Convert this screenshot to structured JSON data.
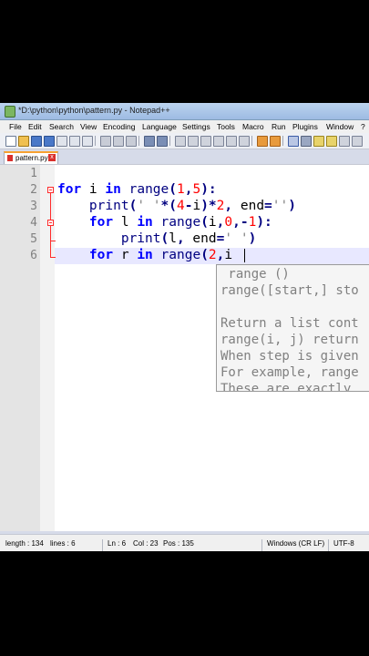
{
  "window": {
    "title": "*D:\\python\\python\\pattern.py - Notepad++"
  },
  "menu": [
    "File",
    "Edit",
    "Search",
    "View",
    "Encoding",
    "Language",
    "Settings",
    "Tools",
    "Macro",
    "Run",
    "Plugins",
    "Window",
    "?"
  ],
  "toolbar": {
    "icons": [
      "new-file-icon",
      "open-file-icon",
      "save-icon",
      "save-all-icon",
      "close-icon",
      "close-all-icon",
      "print-icon",
      "cut-icon",
      "copy-icon",
      "paste-icon",
      "undo-icon",
      "redo-icon",
      "find-icon",
      "replace-icon",
      "zoom-in-icon",
      "zoom-out-icon",
      "sync-v-icon",
      "sync-h-icon",
      "word-wrap-icon",
      "show-all-chars-icon",
      "indent-guide-icon",
      "doc-map-icon",
      "function-list-icon",
      "macro-record-icon"
    ]
  },
  "tab": {
    "label": "pattern.py",
    "close": "x"
  },
  "editor": {
    "line_numbers": [
      "1",
      "2",
      "3",
      "4",
      "5",
      "6"
    ],
    "lines": [
      {
        "t1": ""
      },
      {
        "kw1": "for",
        "t1": " i ",
        "kw2": "in",
        "t2": " ",
        "fn": "range",
        "op1": "(",
        "n1": "1",
        "op2": ",",
        "n2": "5",
        "op3": "):"
      },
      {
        "t0": "    ",
        "fn": "print",
        "op1": "(",
        "s1": "' '",
        "op2": "*(",
        "n1": "4",
        "op3": "-",
        "t1": "i",
        "op4": ")*",
        "n2": "2",
        "op5": ",",
        "t2": " end",
        "op6": "=",
        "s2": "''",
        "op7": ")"
      },
      {
        "t0": "    ",
        "kw1": "for",
        "t1": " l ",
        "kw2": "in",
        "t2": " ",
        "fn": "range",
        "op1": "(",
        "t3": "i",
        "op2": ",",
        "n1": "0",
        "op3": ",-",
        "n2": "1",
        "op4": "):"
      },
      {
        "t0": "        ",
        "fn": "print",
        "op1": "(",
        "t1": "l",
        "op2": ",",
        "t2": " end",
        "op3": "=",
        "s1": "' '",
        "op4": ")"
      },
      {
        "t0": "    ",
        "kw1": "for",
        "t1": " r ",
        "kw2": "in",
        "t2": " ",
        "fn": "range",
        "op1": "(",
        "n1": "2",
        "op2": ",",
        "t3": "i"
      }
    ]
  },
  "calltip": {
    "lines": [
      " range ()",
      "range([start,] sto",
      "",
      "Return a list cont",
      "range(i, j) return",
      "When step is given",
      "For example, range",
      "These are exactly "
    ]
  },
  "status": {
    "length": "length : 134",
    "lines": "lines : 6",
    "ln": "Ln : 6",
    "col": "Col : 23",
    "pos": "Pos : 135",
    "eol": "Windows (CR LF)",
    "encoding": "UTF-8"
  },
  "colors": {
    "keyword": "#0000ff",
    "number": "#ff0000",
    "string": "#808080",
    "operator": "#000080",
    "current_line": "#e8e8ff",
    "fold_marker": "#ff2b2b"
  }
}
